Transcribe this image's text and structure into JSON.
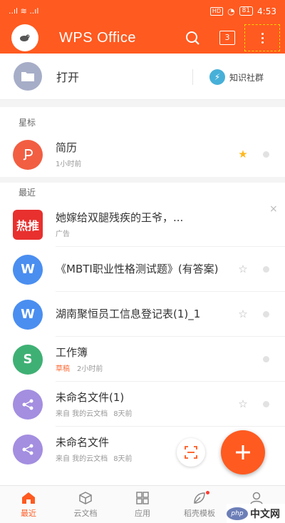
{
  "status_bar": {
    "left": "..ıl ≋ ..ıl",
    "hd": "HD",
    "battery": "81",
    "time": "4:53"
  },
  "app_bar": {
    "title": "WPS Office",
    "tab_count": "3"
  },
  "open_row": {
    "label": "打开",
    "community": "知识社群"
  },
  "sections": {
    "starred": "星标",
    "recent": "最近"
  },
  "starred_file": {
    "name": "简历",
    "meta": "1小时前",
    "icon": "file-icon-P",
    "color": "#f25e42"
  },
  "ad": {
    "icon_text": "热推",
    "title": "她嫁给双腿残疾的王爷，...",
    "meta": "广告",
    "close": "×"
  },
  "recent_files": [
    {
      "name": "《MBTI职业性格测试题》(有答案)",
      "tag": "",
      "source": "",
      "time": "",
      "icon": "W",
      "color": "#4a8ef0"
    },
    {
      "name": "湖南聚恒员工信息登记表(1)_1",
      "tag": "",
      "source": "",
      "time": "",
      "icon": "W",
      "color": "#4a8ef0"
    },
    {
      "name": "工作簿",
      "tag": "草稿",
      "source": "",
      "time": "2小时前",
      "icon": "S",
      "color": "#3fb074"
    },
    {
      "name": "未命名文件(1)",
      "tag": "",
      "source": "来自 我的云文档",
      "time": "8天前",
      "icon": "share",
      "color": "#a38ee0"
    },
    {
      "name": "未命名文件",
      "tag": "",
      "source": "来自 我的云文档",
      "time": "8天前",
      "icon": "share",
      "color": "#a38ee0"
    }
  ],
  "bottom_nav": [
    {
      "label": "最近",
      "icon": "home-icon"
    },
    {
      "label": "云文档",
      "icon": "cube-icon"
    },
    {
      "label": "应用",
      "icon": "grid-icon"
    },
    {
      "label": "稻壳模板",
      "icon": "leaf-icon"
    },
    {
      "label": "我",
      "icon": "user-icon"
    }
  ],
  "watermark": {
    "logo": "php",
    "text": "中文网"
  },
  "colors": {
    "accent": "#ff5a20",
    "highlight": "#ffd400"
  }
}
